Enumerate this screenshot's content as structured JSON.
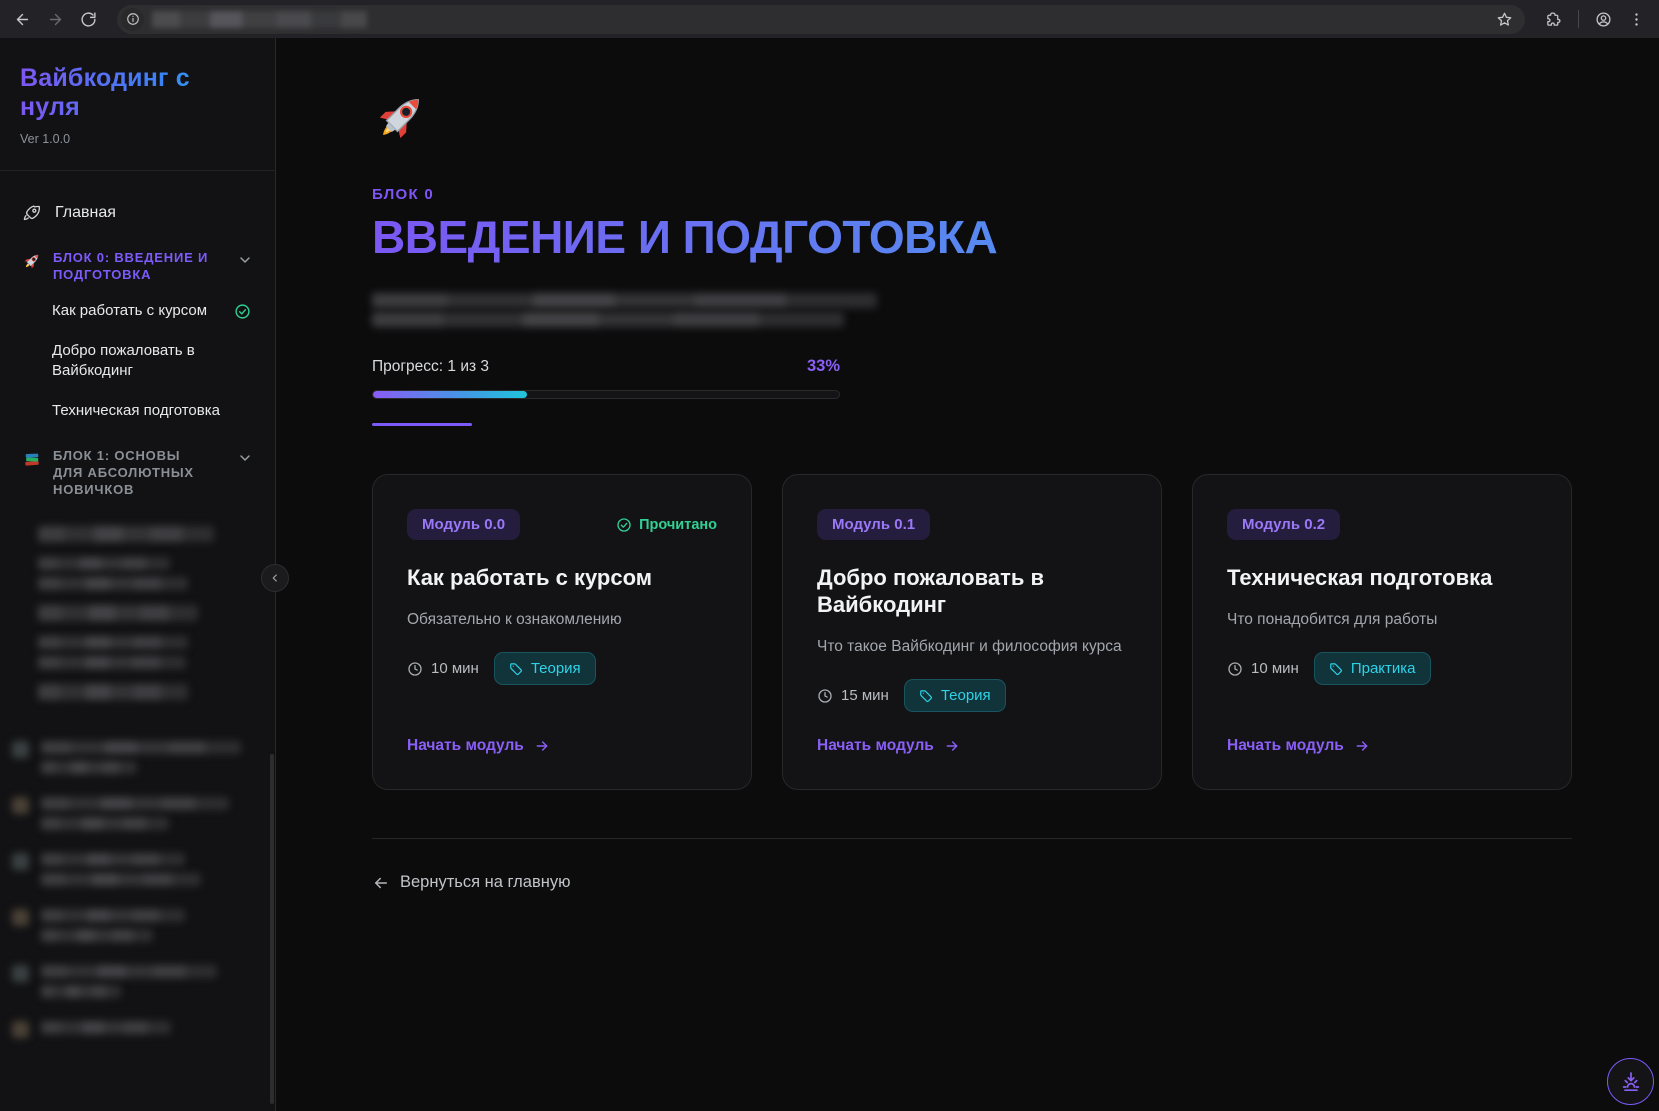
{
  "sidebar": {
    "title": "Вайбкодинг с нуля",
    "version": "Ver 1.0.0",
    "home_label": "Главная",
    "sections": [
      {
        "label": "БЛОК 0: ВВЕДЕНИЕ И ПОДГОТОВКА",
        "items": [
          "Как работать с курсом",
          "Добро пожаловать в Вайбкодинг",
          "Техническая подготовка"
        ]
      },
      {
        "label": "БЛОК 1: ОСНОВЫ ДЛЯ АБСОЛЮТНЫХ НОВИЧКОВ"
      }
    ]
  },
  "main": {
    "block_label": "БЛОК 0",
    "title": "ВВЕДЕНИЕ И ПОДГОТОВКА",
    "progress_label": "Прогресс: 1 из 3",
    "progress_percent_label": "33%",
    "progress_value": 33,
    "cards": [
      {
        "badge": "Модуль 0.0",
        "status": "Прочитано",
        "title": "Как работать с курсом",
        "description": "Обязательно к ознакомлению",
        "duration": "10 мин",
        "tag": "Теория",
        "cta": "Начать модуль"
      },
      {
        "badge": "Модуль 0.1",
        "title": "Добро пожаловать в Вайбкодинг",
        "description": "Что такое Вайбкодинг и философия курса",
        "duration": "15 мин",
        "tag": "Теория",
        "cta": "Начать модуль"
      },
      {
        "badge": "Модуль 0.2",
        "title": "Техническая подготовка",
        "description": "Что понадобится для работы",
        "duration": "10 мин",
        "tag": "Практика",
        "cta": "Начать модуль"
      }
    ],
    "back_label": "Вернуться на главную"
  },
  "colors": {
    "accent_purple": "#8a5ff6",
    "accent_cyan": "#1fc5dc",
    "success_green": "#31d194",
    "tag_cyan": "#2ed3e9",
    "section_purple": "#7d5bfb"
  }
}
